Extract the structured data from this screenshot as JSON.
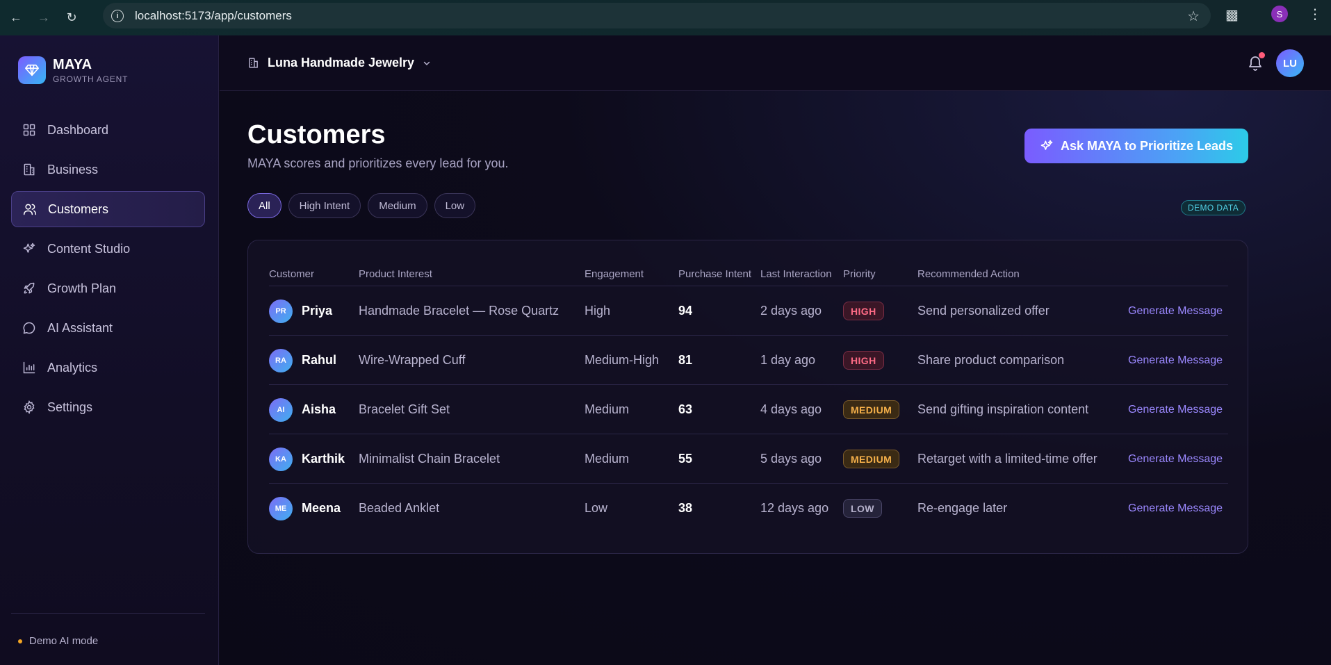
{
  "browser": {
    "url": "localhost:5173/app/customers",
    "profile_initial": "S"
  },
  "brand": {
    "name": "MAYA",
    "subtitle": "GROWTH AGENT"
  },
  "sidebar": {
    "items": [
      {
        "label": "Dashboard",
        "icon": "grid-icon"
      },
      {
        "label": "Business",
        "icon": "building-icon"
      },
      {
        "label": "Customers",
        "icon": "users-icon",
        "active": true
      },
      {
        "label": "Content Studio",
        "icon": "sparkles-icon"
      },
      {
        "label": "Growth Plan",
        "icon": "rocket-icon"
      },
      {
        "label": "AI Assistant",
        "icon": "chat-icon"
      },
      {
        "label": "Analytics",
        "icon": "bar-chart-icon"
      },
      {
        "label": "Settings",
        "icon": "gear-icon"
      }
    ],
    "footer": "Demo AI mode"
  },
  "header": {
    "workspace": "Luna Handmade Jewelry",
    "user_initials": "LU"
  },
  "page": {
    "title": "Customers",
    "subtitle": "MAYA scores and prioritizes every lead for you.",
    "cta_label": "Ask MAYA to Prioritize Leads",
    "demo_badge": "DEMO DATA",
    "filters": [
      "All",
      "High Intent",
      "Medium",
      "Low"
    ],
    "active_filter": "All"
  },
  "table": {
    "columns": [
      "Customer",
      "Product Interest",
      "Engagement",
      "Purchase Intent",
      "Last Interaction",
      "Priority",
      "Recommended Action"
    ],
    "rows": [
      {
        "initials": "PR",
        "name": "Priya",
        "product": "Handmade Bracelet — Rose Quartz",
        "engagement": "High",
        "intent": "94",
        "last": "2 days ago",
        "priority": "HIGH",
        "action": "Send personalized offer",
        "link": "Generate Message"
      },
      {
        "initials": "RA",
        "name": "Rahul",
        "product": "Wire-Wrapped Cuff",
        "engagement": "Medium-High",
        "intent": "81",
        "last": "1 day ago",
        "priority": "HIGH",
        "action": "Share product comparison",
        "link": "Generate Message"
      },
      {
        "initials": "AI",
        "name": "Aisha",
        "product": "Bracelet Gift Set",
        "engagement": "Medium",
        "intent": "63",
        "last": "4 days ago",
        "priority": "MEDIUM",
        "action": "Send gifting inspiration content",
        "link": "Generate Message"
      },
      {
        "initials": "KA",
        "name": "Karthik",
        "product": "Minimalist Chain Bracelet",
        "engagement": "Medium",
        "intent": "55",
        "last": "5 days ago",
        "priority": "MEDIUM",
        "action": "Retarget with a limited-time offer",
        "link": "Generate Message"
      },
      {
        "initials": "ME",
        "name": "Meena",
        "product": "Beaded Anklet",
        "engagement": "Low",
        "intent": "38",
        "last": "12 days ago",
        "priority": "LOW",
        "action": "Re-engage later",
        "link": "Generate Message"
      }
    ]
  },
  "colors": {
    "accent": "#7a5cff",
    "accent_cyan": "#2ccbe8",
    "high": "#ff6b86",
    "medium": "#f5b04a",
    "low": "#b6b2cc"
  }
}
